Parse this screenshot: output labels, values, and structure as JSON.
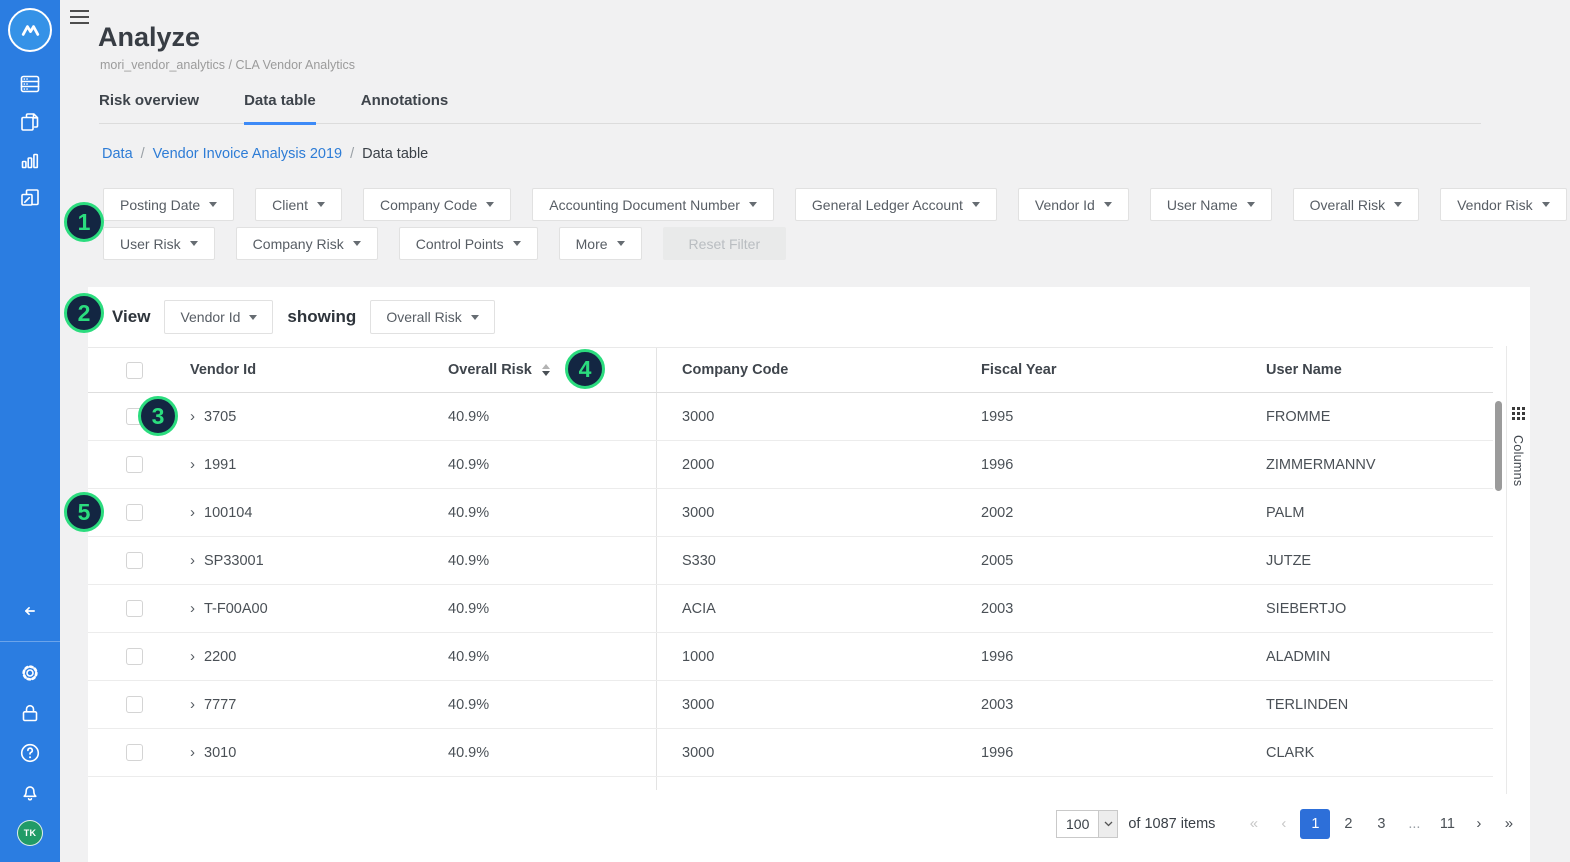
{
  "colors": {
    "sidebar_bg": "#2b7de1",
    "accent_blue": "#3d8af7",
    "link_blue": "#2d7cd6",
    "active_page_bg": "#2d6fd9",
    "badge_bg": "#132642",
    "badge_green": "#2bdc7e",
    "avatar_bg": "#219b67"
  },
  "sidebar": {
    "nav_icons": [
      "data-icon",
      "documents-icon",
      "analytics-icon",
      "annotations-icon"
    ],
    "footer_icons": [
      "settings-icon",
      "lock-icon",
      "help-icon",
      "notifications-icon"
    ],
    "avatar_initials": "TK"
  },
  "header": {
    "title": "Analyze",
    "subtitle": "mori_vendor_analytics / CLA Vendor Analytics",
    "tabs": [
      {
        "label": "Risk overview",
        "active": false
      },
      {
        "label": "Data table",
        "active": true
      },
      {
        "label": "Annotations",
        "active": false
      }
    ]
  },
  "breadcrumb": {
    "separator": "/",
    "items": [
      {
        "label": "Data",
        "link": true
      },
      {
        "label": "Vendor Invoice Analysis 2019",
        "link": true
      },
      {
        "label": "Data table",
        "link": false
      }
    ]
  },
  "filters": {
    "row1": [
      "Posting Date",
      "Client",
      "Company Code",
      "Accounting Document Number",
      "General Ledger Account",
      "Vendor Id",
      "User Name",
      "Overall Risk",
      "Vendor Risk"
    ],
    "row2": [
      "User Risk",
      "Company Risk",
      "Control Points",
      "More"
    ],
    "reset_label": "Reset Filter"
  },
  "view_bar": {
    "view_label": "View",
    "view_value": "Vendor Id",
    "showing_label": "showing",
    "showing_value": "Overall Risk"
  },
  "table": {
    "columns": {
      "vendor_id": "Vendor Id",
      "overall_risk": "Overall Risk",
      "company_code": "Company Code",
      "fiscal_year": "Fiscal Year",
      "user_name": "User Name"
    },
    "sort_indicator_column": "Overall Risk",
    "rows": [
      {
        "vendor_id": "3705",
        "overall_risk": "40.9%",
        "company_code": "3000",
        "fiscal_year": "1995",
        "user_name": "FROMME"
      },
      {
        "vendor_id": "1991",
        "overall_risk": "40.9%",
        "company_code": "2000",
        "fiscal_year": "1996",
        "user_name": "ZIMMERMANNV"
      },
      {
        "vendor_id": "100104",
        "overall_risk": "40.9%",
        "company_code": "3000",
        "fiscal_year": "2002",
        "user_name": "PALM"
      },
      {
        "vendor_id": "SP33001",
        "overall_risk": "40.9%",
        "company_code": "S330",
        "fiscal_year": "2005",
        "user_name": "JUTZE"
      },
      {
        "vendor_id": "T-F00A00",
        "overall_risk": "40.9%",
        "company_code": "ACIA",
        "fiscal_year": "2003",
        "user_name": "SIEBERTJO"
      },
      {
        "vendor_id": "2200",
        "overall_risk": "40.9%",
        "company_code": "1000",
        "fiscal_year": "1996",
        "user_name": "ALADMIN"
      },
      {
        "vendor_id": "7777",
        "overall_risk": "40.9%",
        "company_code": "3000",
        "fiscal_year": "2003",
        "user_name": "TERLINDEN"
      },
      {
        "vendor_id": "3010",
        "overall_risk": "40.9%",
        "company_code": "3000",
        "fiscal_year": "1996",
        "user_name": "CLARK"
      }
    ]
  },
  "columns_panel": {
    "label": "Columns"
  },
  "pagination": {
    "page_size": "100",
    "items_text": "of 1087 items",
    "first": "«",
    "prev": "‹",
    "next": "›",
    "last": "»",
    "pages": [
      "1",
      "2",
      "3",
      "...",
      "11"
    ],
    "active_page": "1"
  },
  "annotation_badges": [
    "1",
    "2",
    "3",
    "4",
    "5"
  ]
}
